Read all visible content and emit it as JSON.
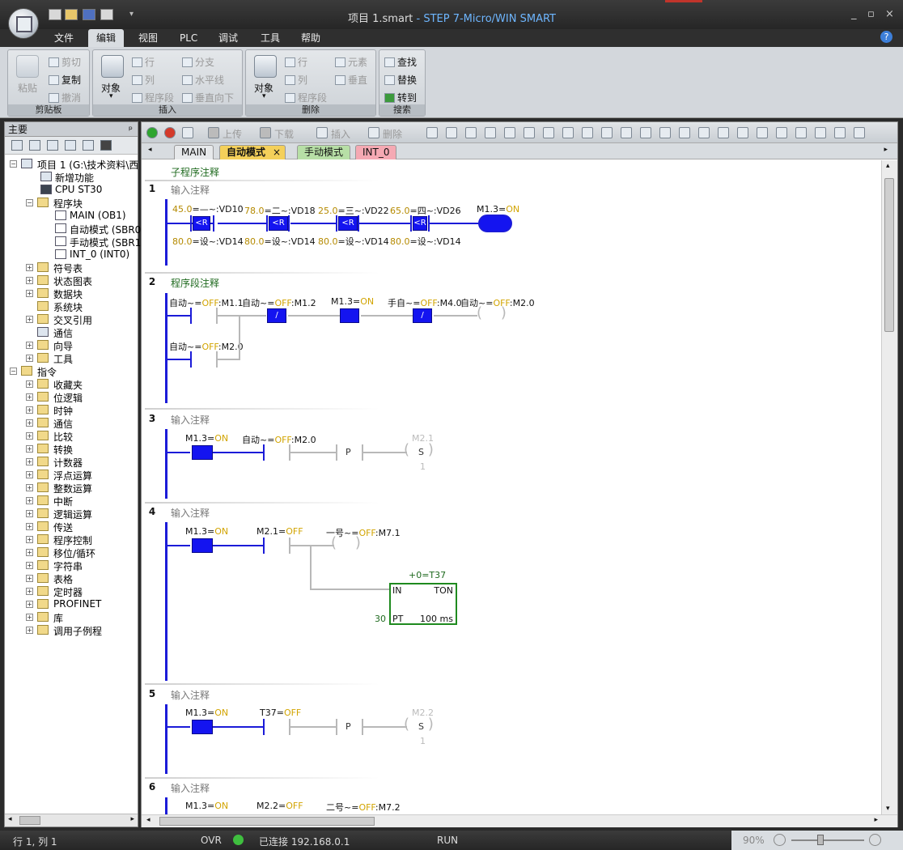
{
  "window": {
    "title": "项目 1.smart",
    "app": " - STEP 7-Micro/WIN SMART",
    "controls": [
      "_",
      "▫",
      "×"
    ]
  },
  "menu": {
    "tabs": [
      "文件",
      "编辑",
      "视图",
      "PLC",
      "调试",
      "工具",
      "帮助"
    ],
    "active": 1,
    "help": "?"
  },
  "ribbon": {
    "clipboard": {
      "label": "剪贴板",
      "paste": "粘贴",
      "cut": "剪切",
      "copy": "复制",
      "undo": "撤消"
    },
    "insert": {
      "label": "插入",
      "object": "对象",
      "row": "行",
      "column": "列",
      "network": "程序段",
      "branch": "分支",
      "hline": "水平线",
      "vdown": "垂直向下"
    },
    "delete": {
      "label": "删除",
      "object": "对象",
      "row": "行",
      "column": "列",
      "network": "程序段",
      "element": "元素",
      "vertical": "垂直"
    },
    "search": {
      "label": "搜索",
      "find": "查找",
      "replace": "替换",
      "goto": "转到"
    }
  },
  "left_panel": {
    "title": "主要",
    "pin": "ᵖ",
    "project": {
      "name": "项目 1 (G:\\技术资料\\西",
      "items": [
        "新增功能",
        "CPU ST30"
      ],
      "blocks": {
        "label": "程序块",
        "children": [
          "MAIN (OB1)",
          "自动模式 (SBR0",
          "手动模式 (SBR1",
          "INT_0 (INT0)"
        ]
      },
      "more": [
        "符号表",
        "状态图表",
        "数据块",
        "系统块",
        "交叉引用",
        "通信",
        "向导",
        "工具"
      ]
    },
    "instructions": {
      "label": "指令",
      "items": [
        "收藏夹",
        "位逻辑",
        "时钟",
        "通信",
        "比较",
        "转换",
        "计数器",
        "浮点运算",
        "整数运算",
        "中断",
        "逻辑运算",
        "传送",
        "程序控制",
        "移位/循环",
        "字符串",
        "表格",
        "定时器",
        "PROFINET",
        "库",
        "调用子例程"
      ]
    }
  },
  "editor": {
    "toolbar": {
      "upload": "上传",
      "download": "下载",
      "insert": "插入",
      "delete": "删除"
    },
    "tabs": [
      "MAIN",
      "自动模式",
      "手动模式",
      "INT_0"
    ],
    "active_tab": 1,
    "sub_comment": "子程序注释",
    "networks": [
      {
        "num": "1",
        "comment": "输入注释",
        "tops": [
          {
            "v": "45.0",
            "s": "=—~:VD10"
          },
          {
            "v": "78.0",
            "s": "=二~:VD18"
          },
          {
            "v": "25.0",
            "s": "=三~:VD22"
          },
          {
            "v": "65.0",
            "s": "=四~:VD26"
          }
        ],
        "bottoms": [
          {
            "v": "80.0",
            "s": "=设~:VD14"
          },
          {
            "v": "80.0",
            "s": "=设~:VD14"
          },
          {
            "v": "80.0",
            "s": "=设~:VD14"
          },
          {
            "v": "80.0",
            "s": "=设~:VD14"
          }
        ],
        "op": "<R",
        "coil": {
          "a": "M1.3=",
          "b": "ON"
        }
      },
      {
        "num": "2",
        "comment": "程序段注释",
        "labels": [
          {
            "a": "自动~=",
            "b": "OFF",
            "c": ":M1.1"
          },
          {
            "a": "自动~=",
            "b": "OFF",
            "c": ":M1.2"
          },
          {
            "a": "M1.3=",
            "b": "ON",
            "c": ""
          },
          {
            "a": "手自~=",
            "b": "OFF",
            "c": ":M4.0"
          },
          {
            "a": "自动~=",
            "b": "OFF",
            "c": ":M2.0"
          },
          {
            "a": "自动~=",
            "b": "OFF",
            "c": ":M2.0"
          }
        ],
        "not": "/"
      },
      {
        "num": "3",
        "comment": "输入注释",
        "c1": {
          "a": "M1.3=",
          "b": "ON"
        },
        "c2": {
          "a": "自动~=",
          "b": "OFF",
          "c": ":M2.0"
        },
        "p": "P",
        "coil": "M2.1",
        "s": "S",
        "n": "1"
      },
      {
        "num": "4",
        "comment": "输入注释",
        "c1": {
          "a": "M1.3=",
          "b": "ON"
        },
        "c2": {
          "a": "M2.1=",
          "b": "OFF"
        },
        "coil": {
          "a": "一号~=",
          "b": "OFF",
          "c": ":M7.1"
        },
        "timer": {
          "value": "+0=T37",
          "in": "IN",
          "type": "TON",
          "pt": "PT",
          "pt_val": "30",
          "base": "100 ms"
        }
      },
      {
        "num": "5",
        "comment": "输入注释",
        "c1": {
          "a": "M1.3=",
          "b": "ON"
        },
        "c2": {
          "a": "T37=",
          "b": "OFF"
        },
        "p": "P",
        "coil": "M2.2",
        "s": "S",
        "n": "1"
      },
      {
        "num": "6",
        "comment": "输入注释",
        "c1": {
          "a": "M1.3=",
          "b": "ON"
        },
        "c2": {
          "a": "M2.2=",
          "b": "OFF"
        },
        "coil": {
          "a": "二号~=",
          "b": "OFF",
          "c": ":M7.2"
        }
      }
    ]
  },
  "status": {
    "pos": "行 1, 列 1",
    "ovr": "OVR",
    "conn": "已连接 192.168.0.1",
    "run": "RUN",
    "zoom": "90%"
  },
  "colors": {
    "rail": "#1b1bd8",
    "contact": "#1414f0",
    "value": "#b58a00",
    "status_ok": "#3fbf3f"
  }
}
